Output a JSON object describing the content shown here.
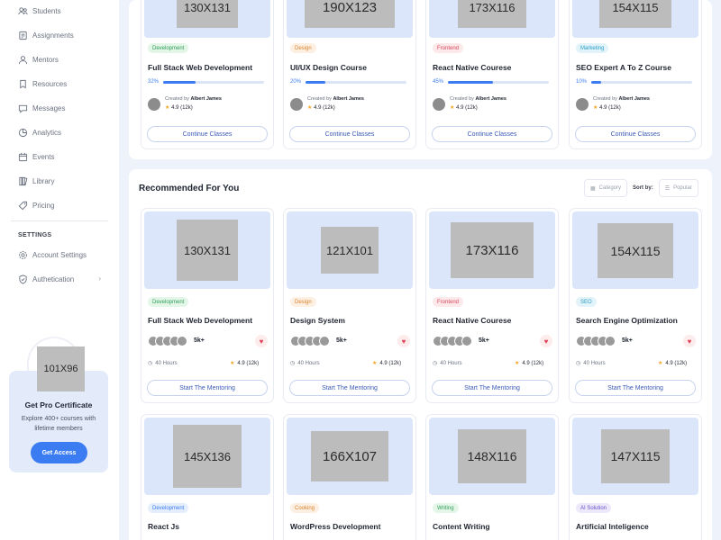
{
  "sidebar": {
    "items": [
      {
        "label": "Students",
        "icon": "students-icon"
      },
      {
        "label": "Assignments",
        "icon": "assignments-icon"
      },
      {
        "label": "Mentors",
        "icon": "mentors-icon"
      },
      {
        "label": "Resources",
        "icon": "resources-icon"
      },
      {
        "label": "Messages",
        "icon": "messages-icon"
      },
      {
        "label": "Analytics",
        "icon": "analytics-icon"
      },
      {
        "label": "Events",
        "icon": "events-icon"
      },
      {
        "label": "Library",
        "icon": "library-icon"
      },
      {
        "label": "Pricing",
        "icon": "pricing-icon"
      }
    ],
    "settings_label": "SETTINGS",
    "settings_items": [
      {
        "label": "Account Settings",
        "icon": "gear-icon"
      },
      {
        "label": "Authetication",
        "icon": "shield-icon"
      }
    ],
    "promo": {
      "image_label": "101X96",
      "title": "Get Pro Certificate",
      "subtitle": "Explore 400+ courses with lifetime members",
      "button": "Get Access"
    }
  },
  "colors": {
    "accent": "#3b7cf3",
    "thumb_bg": "#dbe6fb",
    "page_bg": "#eef2fb"
  },
  "in_progress": [
    {
      "image_label": "130X131",
      "tag": "Development",
      "tag_color": "#e4f6e8",
      "tag_text": "#2f9e57",
      "title": "Full Stack Web Development",
      "progress_label": "32%",
      "progress": 0.32,
      "created_by": "Created by",
      "author": "Albert James",
      "rating": "4.9 (12k)",
      "button": "Continue Classes"
    },
    {
      "image_label": "190X123",
      "tag": "Design",
      "tag_color": "#fdf0e3",
      "tag_text": "#d9822b",
      "title": "UI/UX Design Course",
      "progress_label": "20%",
      "progress": 0.2,
      "created_by": "Created by",
      "author": "Albert James",
      "rating": "4.9 (12k)",
      "button": "Continue Classes"
    },
    {
      "image_label": "173X116",
      "tag": "Frontend",
      "tag_color": "#fde8ea",
      "tag_text": "#d9485f",
      "title": "React Native Courese",
      "progress_label": "45%",
      "progress": 0.45,
      "created_by": "Created by",
      "author": "Albert James",
      "rating": "4.9 (12k)",
      "button": "Continue Classes"
    },
    {
      "image_label": "154X115",
      "tag": "Marketing",
      "tag_color": "#e2f4fa",
      "tag_text": "#2a9cc6",
      "title": "SEO Expert A To Z Course",
      "progress_label": "10%",
      "progress": 0.1,
      "created_by": "Created by",
      "author": "Albert James",
      "rating": "4.9 (12k)",
      "button": "Continue Classes"
    }
  ],
  "recommended": {
    "title": "Recommended For You",
    "category_label": "Category",
    "sort_label": "Sort by:",
    "sort_value": "Popular",
    "cards": [
      {
        "image_label": "130X131",
        "tag": "Development",
        "tag_color": "#e4f6e8",
        "tag_text": "#2f9e57",
        "title": "Full Stack Web Development",
        "count": "5k+",
        "hours": "40 Hours",
        "rating": "4.9 (12k)",
        "button": "Start The Mentoring"
      },
      {
        "image_label": "121X101",
        "tag": "Design",
        "tag_color": "#fdf0e3",
        "tag_text": "#d9822b",
        "title": "Design System",
        "count": "5k+",
        "hours": "40 Hours",
        "rating": "4.9 (12k)",
        "button": "Start The Mentoring"
      },
      {
        "image_label": "173X116",
        "tag": "Frontend",
        "tag_color": "#fde8ea",
        "tag_text": "#d9485f",
        "title": "React Native Courese",
        "count": "5k+",
        "hours": "40 Hours",
        "rating": "4.9 (12k)",
        "button": "Start The Mentoring"
      },
      {
        "image_label": "154X115",
        "tag": "SEO",
        "tag_color": "#e2f4fa",
        "tag_text": "#2a9cc6",
        "title": "Search Engine Optimization",
        "count": "5k+",
        "hours": "40 Hours",
        "rating": "4.9 (12k)",
        "button": "Start The Mentoring"
      }
    ],
    "cards2": [
      {
        "image_label": "145X136",
        "tag": "Development",
        "tag_color": "#e5eefc",
        "tag_text": "#3b7cf3",
        "title": "React Js"
      },
      {
        "image_label": "166X107",
        "tag": "Cooking",
        "tag_color": "#fdf0e3",
        "tag_text": "#d9822b",
        "title": "WordPress Development"
      },
      {
        "image_label": "148X116",
        "tag": "Writing",
        "tag_color": "#e4f6e8",
        "tag_text": "#2f9e57",
        "title": "Content Writing"
      },
      {
        "image_label": "147X115",
        "tag": "AI Solution",
        "tag_color": "#ede8fb",
        "tag_text": "#6b52c9",
        "title": "Artificial Inteligence"
      }
    ]
  }
}
